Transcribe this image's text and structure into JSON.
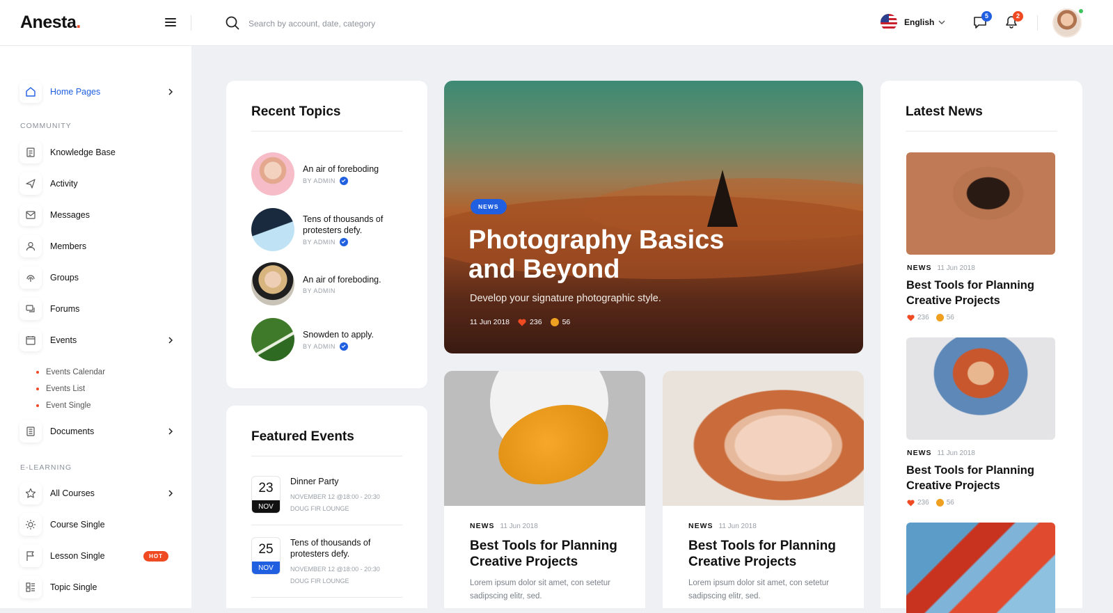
{
  "header": {
    "logo": "Anesta",
    "logo_dot": ".",
    "search_placeholder": "Search by account, date, category",
    "language": "English",
    "messages_count": "5",
    "notifications_count": "2"
  },
  "sidebar": {
    "home": "Home Pages",
    "community_title": "COMMUNITY",
    "community": [
      "Knowledge Base",
      "Activity",
      "Messages",
      "Members",
      "Groups",
      "Forums",
      "Events"
    ],
    "events_sub": [
      "Events Calendar",
      "Events List",
      "Event Single"
    ],
    "documents": "Documents",
    "elearning_title": "E-LEARNING",
    "elearning": [
      "All Courses",
      "Course Single",
      "Lesson Single",
      "Topic Single"
    ],
    "hot_badge": "HOT"
  },
  "recent_topics": {
    "title": "Recent Topics",
    "items": [
      {
        "title": "An air of foreboding",
        "by": "BY ADMIN"
      },
      {
        "title": "Tens of thousands of protesters defy.",
        "by": "BY ADMIN"
      },
      {
        "title": "An air of foreboding.",
        "by": "BY ADMIN"
      },
      {
        "title": "Snowden to apply.",
        "by": "BY ADMIN"
      }
    ]
  },
  "featured_events": {
    "title": "Featured Events",
    "items": [
      {
        "day": "23",
        "month": "NOV",
        "title": "Dinner Party",
        "time": "NOVEMBER 12 @18:00 - 20:30",
        "place": "DOUG FIR LOUNGE",
        "color": "#111111"
      },
      {
        "day": "25",
        "month": "NOV",
        "title": "Tens of thousands of protesters defy.",
        "time": "NOVEMBER 12 @18:00 - 20:30",
        "place": "DOUG FIR LOUNGE",
        "color": "#1f5fe0"
      }
    ]
  },
  "hero": {
    "badge": "NEWS",
    "title": "Photography Basics and Beyond",
    "subtitle": "Develop your signature photographic style.",
    "date": "11 Jun 2018",
    "likes": "236",
    "comments": "56"
  },
  "posts": [
    {
      "tag": "NEWS",
      "date": "11 Jun 2018",
      "title": "Best Tools for Planning Creative Projects",
      "excerpt": "Lorem ipsum dolor sit amet, con setetur sadipscing elitr, sed."
    },
    {
      "tag": "NEWS",
      "date": "11 Jun 2018",
      "title": "Best Tools for Planning Creative Projects",
      "excerpt": "Lorem ipsum dolor sit amet, con setetur sadipscing elitr, sed."
    }
  ],
  "latest_news": {
    "title": "Latest News",
    "items": [
      {
        "tag": "NEWS",
        "date": "11 Jun 2018",
        "title": "Best Tools for Planning Creative Projects",
        "likes": "236",
        "comments": "56"
      },
      {
        "tag": "NEWS",
        "date": "11 Jun 2018",
        "title": "Best Tools for Planning Creative Projects",
        "likes": "236",
        "comments": "56"
      }
    ]
  },
  "colors": {
    "accent": "#1f5fe0",
    "brand_dot": "#f04a23",
    "heart": "#f04a23",
    "comment": "#f0a020"
  }
}
